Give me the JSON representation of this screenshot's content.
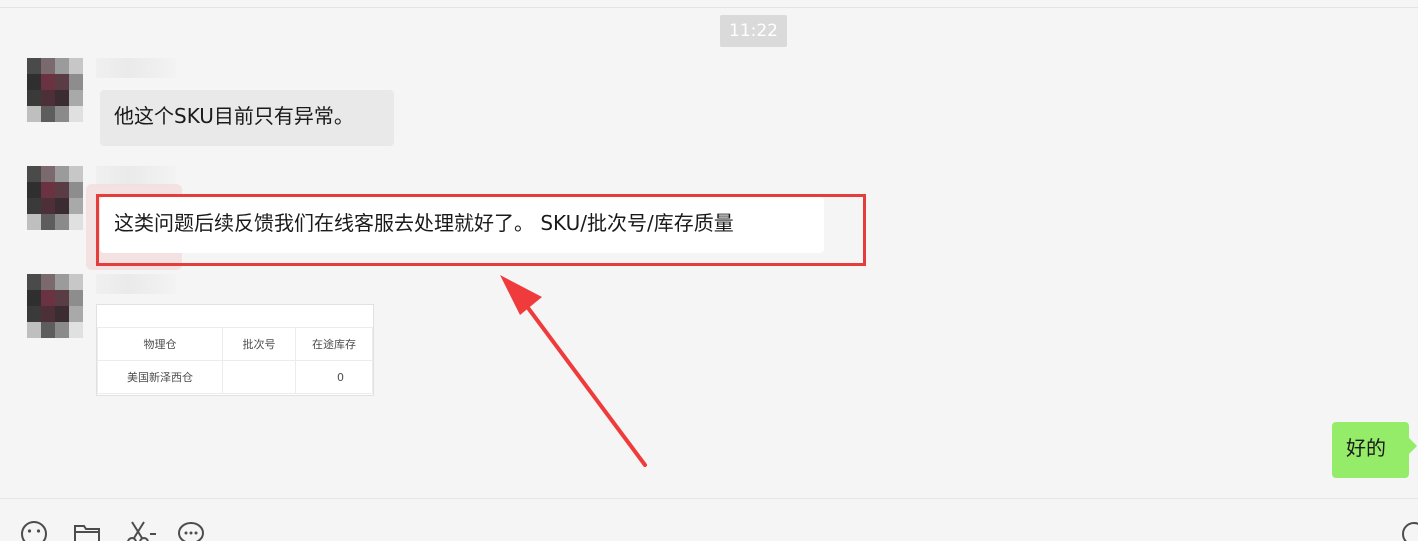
{
  "window": {
    "time": "11:22"
  },
  "messages": [
    {
      "id": 1,
      "side": "left",
      "text": "他这个SKU目前只有异常。"
    },
    {
      "id": 2,
      "side": "left",
      "text": "这类问题后续反馈我们在线客服去处理就好了。 SKU/批次号/库存质量"
    },
    {
      "id": 3,
      "side": "left",
      "type": "image-table",
      "table": {
        "headers": [
          "物理仓",
          "批次号",
          "在途库存"
        ],
        "rows": [
          [
            "美国新泽西仓",
            "",
            "0"
          ]
        ]
      }
    },
    {
      "id": 4,
      "side": "right",
      "text": "好的"
    }
  ],
  "annotation": {
    "box_color": "#e53c3c",
    "arrow_color": "#ef3b3b"
  },
  "toolbar": {
    "icons": [
      "emoji-icon",
      "folder-icon",
      "scissors-icon",
      "chat-bubble-icon",
      "search-icon"
    ]
  },
  "colors": {
    "bubble_in": "#e9e9e9",
    "bubble_out": "#95ec69",
    "background": "#f5f5f5"
  }
}
